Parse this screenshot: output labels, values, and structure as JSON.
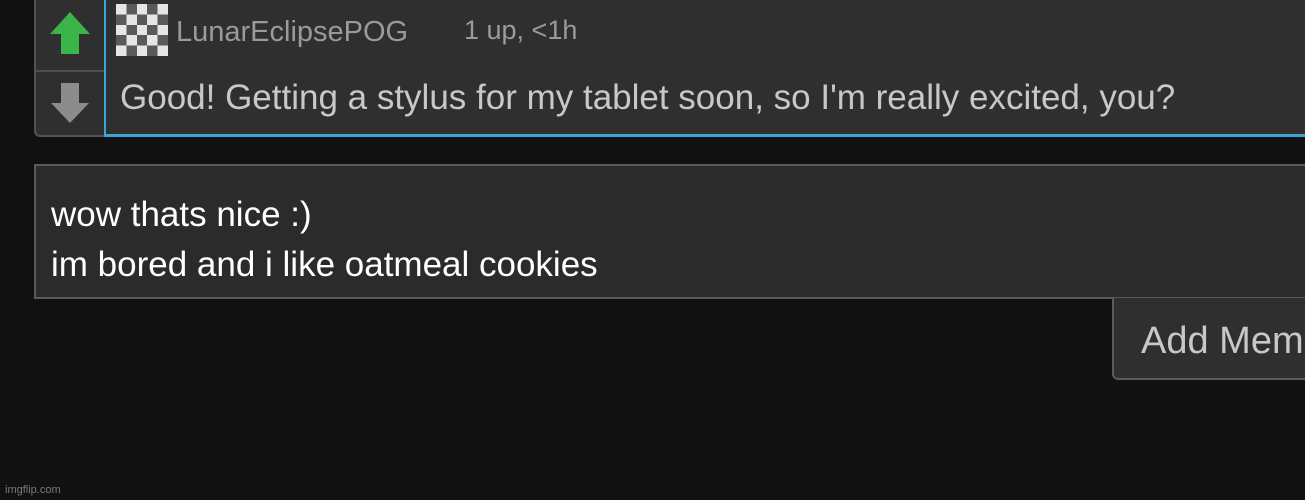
{
  "comment": {
    "username": "LunarEclipsePOG",
    "meta": "1 up, <1h",
    "text": "Good! Getting a stylus for my tablet soon, so I'm really excited, you?",
    "upvote_color": "#3bb44a",
    "downvote_color": "#8c8c8c",
    "accent_color": "#3aa7d8",
    "upvote_icon": "arrow-up-icon",
    "downvote_icon": "arrow-down-icon",
    "avatar_icon": "checkered-avatar-icon"
  },
  "reply": {
    "value": "wow thats nice :)\nim bored and i like oatmeal cookies"
  },
  "actions": {
    "add_meme_label": "Add Meme"
  },
  "watermark": "imgflip.com"
}
